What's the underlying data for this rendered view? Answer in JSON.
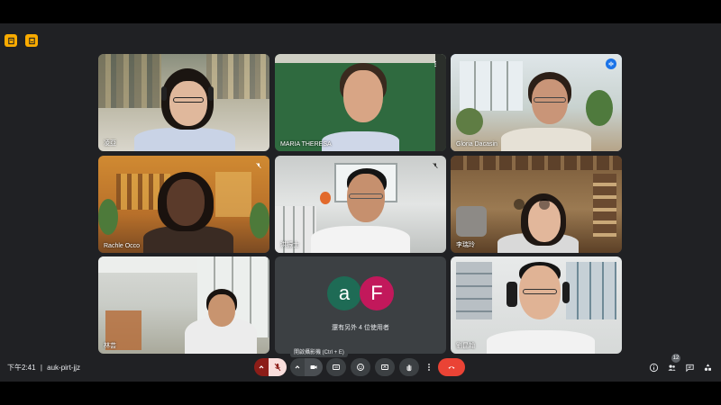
{
  "top_icons": [
    "notes-icon",
    "activities-icon"
  ],
  "tiles": [
    {
      "name": "凌亞"
    },
    {
      "name": "MARIA THERESA"
    },
    {
      "name": "Gloria Dacasin"
    },
    {
      "name": "Rachle Occo"
    },
    {
      "name": "洪振士"
    },
    {
      "name": "李瑞玲"
    },
    {
      "name": "林芸"
    },
    {
      "avatars": [
        "a",
        "F"
      ],
      "others_label": "還有另外 4 位使用者"
    },
    {
      "name": "劉昆翰"
    }
  ],
  "bottom_bar": {
    "time": "下午2:41",
    "separator": "|",
    "meeting_code": "auk-pirt-jjz",
    "tooltip": "開啟攝影機 (Ctrl + E)",
    "participant_count": "12"
  },
  "colors": {
    "background": "#202124",
    "accent": "#8ab4f8",
    "hangup": "#ea4335",
    "avatar_a": "#1e6b55",
    "avatar_f": "#c2185b"
  }
}
